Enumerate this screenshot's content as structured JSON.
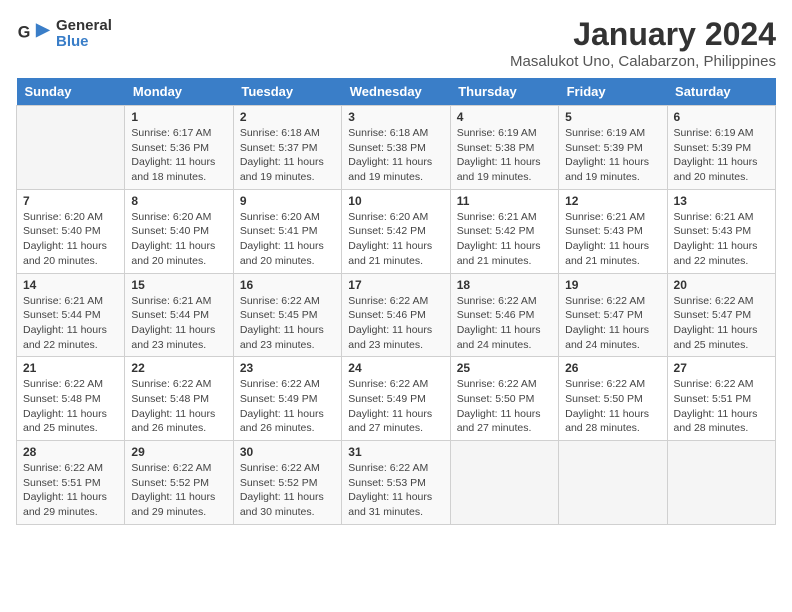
{
  "logo": {
    "line1": "General",
    "line2": "Blue"
  },
  "title": "January 2024",
  "subtitle": "Masalukot Uno, Calabarzon, Philippines",
  "days_header": [
    "Sunday",
    "Monday",
    "Tuesday",
    "Wednesday",
    "Thursday",
    "Friday",
    "Saturday"
  ],
  "weeks": [
    [
      {
        "num": "",
        "info": ""
      },
      {
        "num": "1",
        "info": "Sunrise: 6:17 AM\nSunset: 5:36 PM\nDaylight: 11 hours\nand 18 minutes."
      },
      {
        "num": "2",
        "info": "Sunrise: 6:18 AM\nSunset: 5:37 PM\nDaylight: 11 hours\nand 19 minutes."
      },
      {
        "num": "3",
        "info": "Sunrise: 6:18 AM\nSunset: 5:38 PM\nDaylight: 11 hours\nand 19 minutes."
      },
      {
        "num": "4",
        "info": "Sunrise: 6:19 AM\nSunset: 5:38 PM\nDaylight: 11 hours\nand 19 minutes."
      },
      {
        "num": "5",
        "info": "Sunrise: 6:19 AM\nSunset: 5:39 PM\nDaylight: 11 hours\nand 19 minutes."
      },
      {
        "num": "6",
        "info": "Sunrise: 6:19 AM\nSunset: 5:39 PM\nDaylight: 11 hours\nand 20 minutes."
      }
    ],
    [
      {
        "num": "7",
        "info": "Sunrise: 6:20 AM\nSunset: 5:40 PM\nDaylight: 11 hours\nand 20 minutes."
      },
      {
        "num": "8",
        "info": "Sunrise: 6:20 AM\nSunset: 5:40 PM\nDaylight: 11 hours\nand 20 minutes."
      },
      {
        "num": "9",
        "info": "Sunrise: 6:20 AM\nSunset: 5:41 PM\nDaylight: 11 hours\nand 20 minutes."
      },
      {
        "num": "10",
        "info": "Sunrise: 6:20 AM\nSunset: 5:42 PM\nDaylight: 11 hours\nand 21 minutes."
      },
      {
        "num": "11",
        "info": "Sunrise: 6:21 AM\nSunset: 5:42 PM\nDaylight: 11 hours\nand 21 minutes."
      },
      {
        "num": "12",
        "info": "Sunrise: 6:21 AM\nSunset: 5:43 PM\nDaylight: 11 hours\nand 21 minutes."
      },
      {
        "num": "13",
        "info": "Sunrise: 6:21 AM\nSunset: 5:43 PM\nDaylight: 11 hours\nand 22 minutes."
      }
    ],
    [
      {
        "num": "14",
        "info": "Sunrise: 6:21 AM\nSunset: 5:44 PM\nDaylight: 11 hours\nand 22 minutes."
      },
      {
        "num": "15",
        "info": "Sunrise: 6:21 AM\nSunset: 5:44 PM\nDaylight: 11 hours\nand 23 minutes."
      },
      {
        "num": "16",
        "info": "Sunrise: 6:22 AM\nSunset: 5:45 PM\nDaylight: 11 hours\nand 23 minutes."
      },
      {
        "num": "17",
        "info": "Sunrise: 6:22 AM\nSunset: 5:46 PM\nDaylight: 11 hours\nand 23 minutes."
      },
      {
        "num": "18",
        "info": "Sunrise: 6:22 AM\nSunset: 5:46 PM\nDaylight: 11 hours\nand 24 minutes."
      },
      {
        "num": "19",
        "info": "Sunrise: 6:22 AM\nSunset: 5:47 PM\nDaylight: 11 hours\nand 24 minutes."
      },
      {
        "num": "20",
        "info": "Sunrise: 6:22 AM\nSunset: 5:47 PM\nDaylight: 11 hours\nand 25 minutes."
      }
    ],
    [
      {
        "num": "21",
        "info": "Sunrise: 6:22 AM\nSunset: 5:48 PM\nDaylight: 11 hours\nand 25 minutes."
      },
      {
        "num": "22",
        "info": "Sunrise: 6:22 AM\nSunset: 5:48 PM\nDaylight: 11 hours\nand 26 minutes."
      },
      {
        "num": "23",
        "info": "Sunrise: 6:22 AM\nSunset: 5:49 PM\nDaylight: 11 hours\nand 26 minutes."
      },
      {
        "num": "24",
        "info": "Sunrise: 6:22 AM\nSunset: 5:49 PM\nDaylight: 11 hours\nand 27 minutes."
      },
      {
        "num": "25",
        "info": "Sunrise: 6:22 AM\nSunset: 5:50 PM\nDaylight: 11 hours\nand 27 minutes."
      },
      {
        "num": "26",
        "info": "Sunrise: 6:22 AM\nSunset: 5:50 PM\nDaylight: 11 hours\nand 28 minutes."
      },
      {
        "num": "27",
        "info": "Sunrise: 6:22 AM\nSunset: 5:51 PM\nDaylight: 11 hours\nand 28 minutes."
      }
    ],
    [
      {
        "num": "28",
        "info": "Sunrise: 6:22 AM\nSunset: 5:51 PM\nDaylight: 11 hours\nand 29 minutes."
      },
      {
        "num": "29",
        "info": "Sunrise: 6:22 AM\nSunset: 5:52 PM\nDaylight: 11 hours\nand 29 minutes."
      },
      {
        "num": "30",
        "info": "Sunrise: 6:22 AM\nSunset: 5:52 PM\nDaylight: 11 hours\nand 30 minutes."
      },
      {
        "num": "31",
        "info": "Sunrise: 6:22 AM\nSunset: 5:53 PM\nDaylight: 11 hours\nand 31 minutes."
      },
      {
        "num": "",
        "info": ""
      },
      {
        "num": "",
        "info": ""
      },
      {
        "num": "",
        "info": ""
      }
    ]
  ]
}
